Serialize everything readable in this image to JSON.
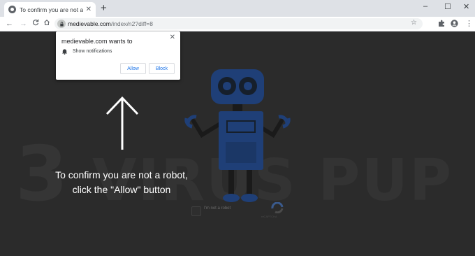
{
  "browser": {
    "tab_title": "To confirm you are not a robot, c",
    "new_tab_label": "+",
    "window_controls": {
      "minimize": "–",
      "maximize": "☐",
      "close": "✕"
    },
    "tab_close_label": "✕",
    "nav": {
      "back": "←",
      "forward": "→",
      "reload": "C",
      "home": "⌂"
    },
    "url_host": "medievable.com",
    "url_path": "/index/n2?diff=8",
    "bookmark_star": "☆",
    "extensions_icon": "puzzle-icon",
    "menu_label": "⋮"
  },
  "permission_popup": {
    "title": "medievable.com wants to",
    "permission": "Show notifications",
    "allow_label": "Allow",
    "block_label": "Block",
    "close_label": "✕"
  },
  "page": {
    "message_line1": "To confirm you are not a robot,",
    "message_line2": "click the \"Allow\" button",
    "watermark_text": "VIRUS PUP",
    "watermark_digit": "3",
    "captcha_label": "I'm not a robot",
    "captcha_sub": "reCAPTCHA"
  },
  "colors": {
    "background": "#2b2b2b",
    "robot_blue": "#1f3f77",
    "allow_text": "#1a73e8",
    "tab_bar": "#dee1e6"
  }
}
